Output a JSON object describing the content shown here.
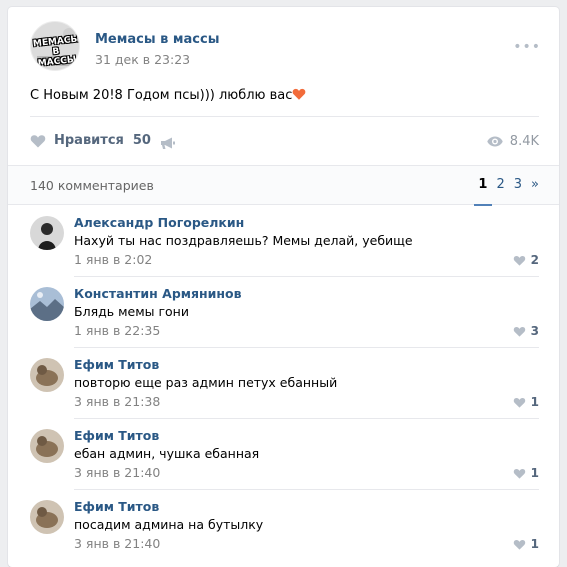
{
  "post": {
    "group_name": "Мемасы в массы",
    "avatar_text_1": "МЕМАСЫ",
    "avatar_text_2": "В МАССЫ",
    "date": "31 дек в 23:23",
    "text": "С Новым 20!8 Годом псы))) люблю вас",
    "like_label": "Нравится",
    "like_count": "50",
    "views": "8.4K"
  },
  "comments_section": {
    "count_label": "140 комментариев",
    "pages": [
      "1",
      "2",
      "3",
      "»"
    ]
  },
  "comments": [
    {
      "author": "Александр Погорелкин",
      "text": "Нахуй ты нас поздравляешь? Мемы делай, уебище",
      "date": "1 янв в 2:02",
      "likes": "2"
    },
    {
      "author": "Константин Армянинов",
      "text": "Блядь мемы гони",
      "date": "1 янв в 22:35",
      "likes": "3"
    },
    {
      "author": "Ефим Титов",
      "text": "повторю еще раз админ петух ебанный",
      "date": "3 янв в 21:38",
      "likes": "1"
    },
    {
      "author": "Ефим Титов",
      "text": "ебан админ, чушка ебанная",
      "date": "3 янв в 21:40",
      "likes": "1"
    },
    {
      "author": "Ефим Титов",
      "text": "посадим админа на бутылку",
      "date": "3 янв в 21:40",
      "likes": "1"
    }
  ],
  "colors": {
    "link": "#2a5885",
    "muted": "#828282",
    "icon": "#b5bdc7",
    "accent": "#5181b8",
    "heart_emoji": "#f26b3a"
  }
}
